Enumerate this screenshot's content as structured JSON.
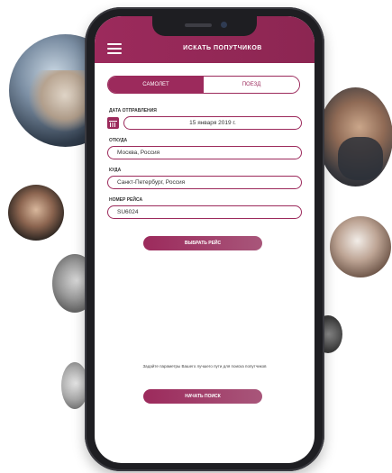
{
  "header": {
    "title": "Искать попутчиков"
  },
  "tabs": [
    {
      "label": "Самолет",
      "active": true
    },
    {
      "label": "Поезд",
      "active": false
    }
  ],
  "form": {
    "date_label": "Дата отправления",
    "date_value": "15 января 2019 г.",
    "from_label": "Откуда",
    "from_value": "Москва, Россия",
    "to_label": "Куда",
    "to_value": "Санкт-Петербург, Россия",
    "flight_label": "Номер рейса",
    "flight_value": "SU6024"
  },
  "buttons": {
    "select_flight": "Выбрать рейс",
    "start_search": "Начать поиск"
  },
  "hint_text": "Задайте параметры Вашего лучшего пути для поиска попутчиков",
  "icons": {
    "menu": "hamburger-icon",
    "calendar": "calendar-icon"
  },
  "colors": {
    "accent": "#9c2a5c"
  }
}
